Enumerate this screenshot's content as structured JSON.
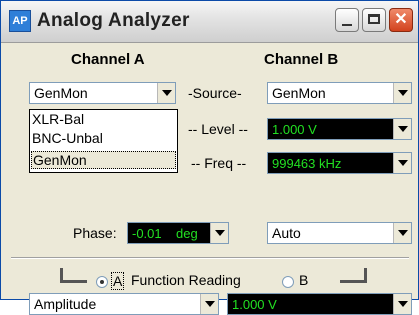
{
  "window": {
    "title": "Analog Analyzer",
    "app_icon_text": "AP"
  },
  "channel_a": {
    "header": "Channel A",
    "source_value": "GenMon",
    "source_options": [
      "XLR-Bal",
      "BNC-Unbal",
      "GenMon"
    ]
  },
  "channel_b": {
    "header": "Channel B",
    "source_value": "GenMon",
    "level_value": "1.000   V",
    "freq_value": "999463 kHz",
    "auto_value": "Auto"
  },
  "labels": {
    "source": "-Source-",
    "level": "-- Level --",
    "freq": "-- Freq --",
    "phase": "Phase:"
  },
  "phase": {
    "value": "-0.01",
    "unit": "deg"
  },
  "function_reading": {
    "label": "Function Reading",
    "option_a": "A",
    "option_b": "B",
    "selected": "A",
    "mode_value": "Amplitude",
    "reading_value": "1.000   V"
  },
  "colors": {
    "readout_bg": "#000000",
    "readout_text": "#22e022",
    "close_button": "#d2421e"
  }
}
